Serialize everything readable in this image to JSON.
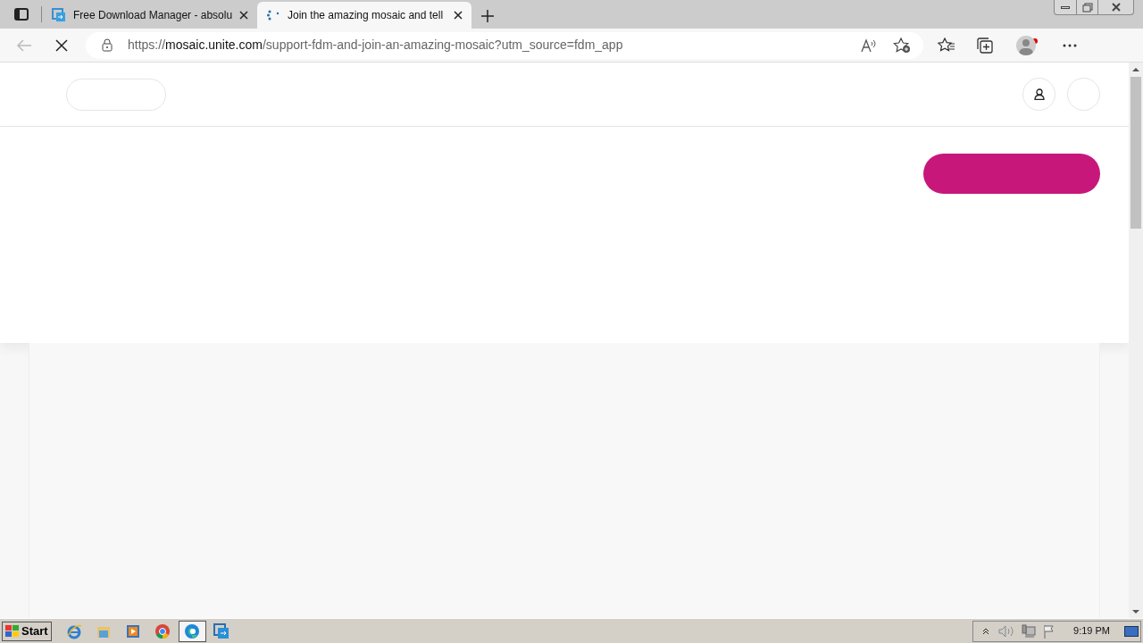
{
  "tabs": [
    {
      "title": "Free Download Manager - absolu",
      "kind": "fdm",
      "selected": false
    },
    {
      "title": "Join the amazing mosaic and tell",
      "kind": "loading",
      "selected": true
    }
  ],
  "address_bar": {
    "scheme": "https://",
    "host": "mosaic.unite.com",
    "path": "/support-fdm-and-join-an-amazing-mosaic?utm_source=fdm_app"
  },
  "taskbar": {
    "start_label": "Start",
    "apps": [
      {
        "kind": "ie",
        "selected": false
      },
      {
        "kind": "folder",
        "selected": false
      },
      {
        "kind": "media",
        "selected": false
      },
      {
        "kind": "chrome",
        "selected": false
      },
      {
        "kind": "edge",
        "selected": true
      },
      {
        "kind": "fdm",
        "selected": false
      }
    ],
    "clock": "9:19 PM"
  }
}
